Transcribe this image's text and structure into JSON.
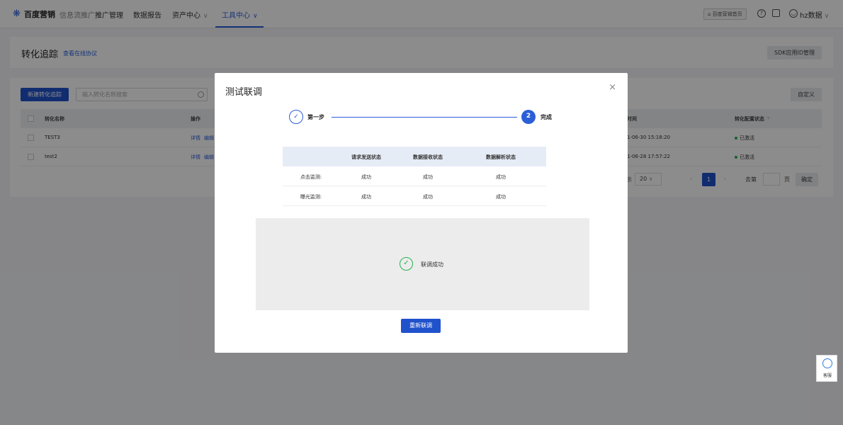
{
  "topnav": {
    "brand": "百度营销",
    "brand_sub": "信息流推广",
    "items": [
      {
        "label": "推广管理"
      },
      {
        "label": "数据报告"
      },
      {
        "label": "资产中心"
      },
      {
        "label": "工具中心"
      }
    ],
    "home_label": "百度营销首页",
    "help_glyph": "?",
    "user_name": "hz数据",
    "accent_color": "#2b5fd9"
  },
  "page": {
    "title": "转化追踪",
    "protocol_link": "查看在线协议",
    "sdk_button": "SDK应用ID管理"
  },
  "list": {
    "new_button": "新建转化追踪",
    "search_placeholder": "输入转化名称搜索",
    "custom_button": "自定义",
    "columns": {
      "name": "转化名称",
      "op": "操作",
      "time": "时间",
      "status": "转化配置状态"
    },
    "rows": [
      {
        "name": "TEST3",
        "op_detail": "详情",
        "op_edit": "编辑",
        "time": "1-06-30 15:18:20",
        "status": "已激活"
      },
      {
        "name": "test2",
        "op_detail": "详情",
        "op_edit": "编辑",
        "time": "1-06-28 17:57:22",
        "status": "已激活"
      }
    ],
    "pagination": {
      "size_prefix": "示",
      "page_size": "20",
      "current_page": "1",
      "goto_label": "去第",
      "page_unit": "页",
      "confirm": "确定"
    }
  },
  "modal": {
    "title": "测试联调",
    "close_glyph": "×",
    "steps": [
      {
        "glyph": "✓",
        "label": "第一步"
      },
      {
        "glyph": "2",
        "label": "完成"
      }
    ],
    "table": {
      "headers": [
        "请求发送状态",
        "数据接收状态",
        "数据解析状态"
      ],
      "rows": [
        {
          "label": "点击监测:",
          "values": [
            "成功",
            "成功",
            "成功"
          ]
        },
        {
          "label": "曝光监测:",
          "values": [
            "成功",
            "成功",
            "成功"
          ]
        }
      ]
    },
    "result_glyph": "✓",
    "result_text": "联调成功",
    "redo_button": "重新联调",
    "success_color": "#22b24c"
  },
  "support": {
    "label": "客服"
  }
}
